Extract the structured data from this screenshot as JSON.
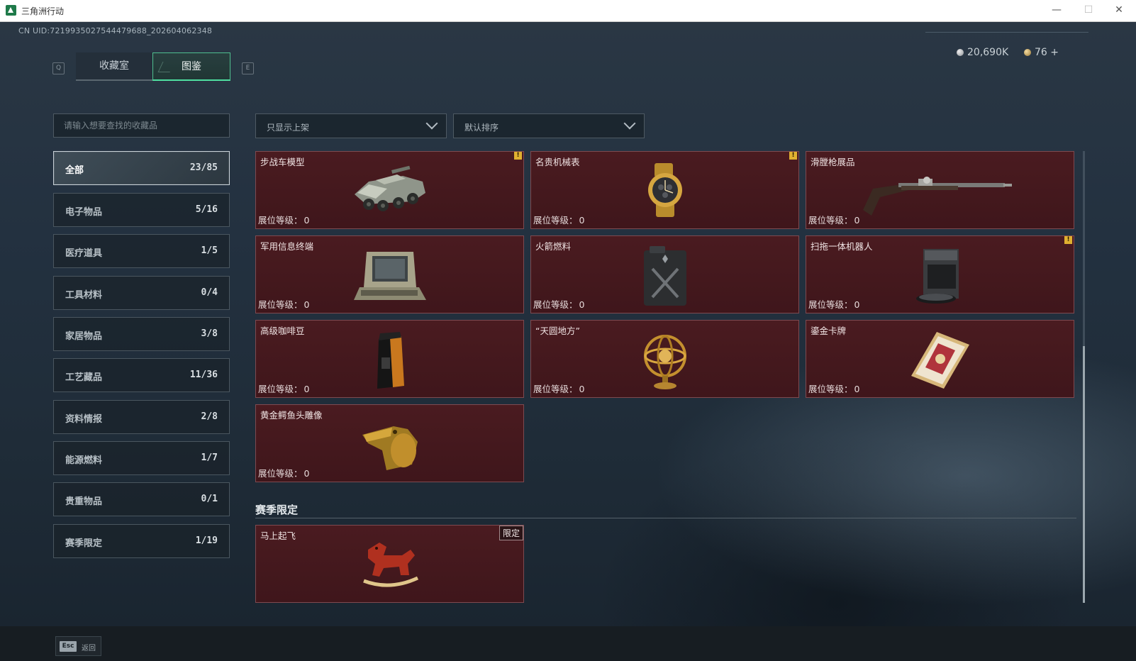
{
  "window": {
    "title": "三角洲行动"
  },
  "header": {
    "uid": "CN UID:7219935027544479688_202604062348",
    "key_left": "Q",
    "key_right": "E",
    "tabs": [
      {
        "label": "收藏室",
        "active": false
      },
      {
        "label": "图鉴",
        "active": true
      }
    ],
    "currency": [
      {
        "value": "20,690K",
        "icon": "silver-coin-icon"
      },
      {
        "value": "76 +",
        "icon": "gold-coin-icon"
      }
    ]
  },
  "search": {
    "placeholder": "请输入想要查找的收藏品"
  },
  "categories": [
    {
      "label": "全部",
      "count": "23/85",
      "active": true
    },
    {
      "label": "电子物品",
      "count": "5/16"
    },
    {
      "label": "医疗道具",
      "count": "1/5"
    },
    {
      "label": "工具材料",
      "count": "0/4"
    },
    {
      "label": "家居物品",
      "count": "3/8"
    },
    {
      "label": "工艺藏品",
      "count": "11/36"
    },
    {
      "label": "资料情报",
      "count": "2/8"
    },
    {
      "label": "能源燃料",
      "count": "1/7"
    },
    {
      "label": "贵重物品",
      "count": "0/1"
    },
    {
      "label": "赛季限定",
      "count": "1/19"
    }
  ],
  "filters": {
    "show_filter": "只显示上架",
    "sort": "默认排序"
  },
  "level_label": "展位等级：",
  "items": [
    {
      "name": "步战车模型",
      "level": "0",
      "alert": true,
      "art": "apc-model"
    },
    {
      "name": "名贵机械表",
      "level": "0",
      "alert": true,
      "art": "watch"
    },
    {
      "name": "滑膛枪展品",
      "level": "0",
      "alert": false,
      "art": "musket"
    },
    {
      "name": "军用信息终端",
      "level": "0",
      "alert": false,
      "art": "terminal"
    },
    {
      "name": "火箭燃料",
      "level": "0",
      "alert": false,
      "art": "jerrycan"
    },
    {
      "name": "扫拖一体机器人",
      "level": "0",
      "alert": true,
      "art": "robot-vacuum"
    },
    {
      "name": "高级咖啡豆",
      "level": "0",
      "alert": false,
      "art": "coffee-bag"
    },
    {
      "name": "“天圆地方”",
      "level": "0",
      "alert": false,
      "art": "armillary-sphere"
    },
    {
      "name": "鎏金卡牌",
      "level": "0",
      "alert": false,
      "art": "gilded-card"
    },
    {
      "name": "黄金鳄鱼头雕像",
      "level": "0",
      "alert": false,
      "art": "gold-crocodile"
    }
  ],
  "season_section": {
    "title": "赛季限定",
    "items": [
      {
        "name": "马上起飞",
        "limited_label": "限定",
        "art": "rocking-horse"
      }
    ]
  },
  "footer": {
    "esc_key": "Esc",
    "esc_label": "返回"
  },
  "colors": {
    "card_bg": "#4a1b20",
    "accent_green": "#4fe0a0",
    "alert_yellow": "#e0b030"
  }
}
